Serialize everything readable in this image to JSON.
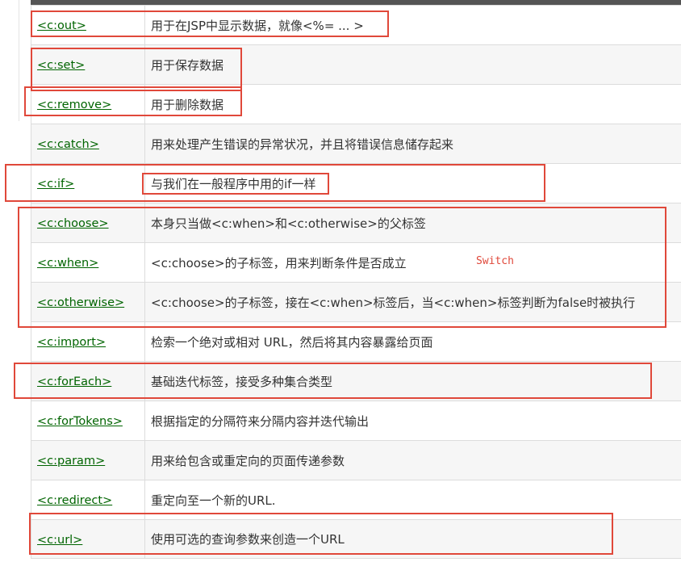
{
  "rows": [
    {
      "tag": "<c:out>",
      "desc": "用于在JSP中显示数据，就像<%= ... >"
    },
    {
      "tag": "<c:set>",
      "desc": "用于保存数据"
    },
    {
      "tag": "<c:remove>",
      "desc": "用于删除数据"
    },
    {
      "tag": "<c:catch>",
      "desc": "用来处理产生错误的异常状况，并且将错误信息储存起来"
    },
    {
      "tag": "<c:if>",
      "desc": "与我们在一般程序中用的if一样"
    },
    {
      "tag": "<c:choose>",
      "desc": "本身只当做<c:when>和<c:otherwise>的父标签"
    },
    {
      "tag": "<c:when>",
      "desc": "<c:choose>的子标签，用来判断条件是否成立"
    },
    {
      "tag": "<c:otherwise>",
      "desc": "<c:choose>的子标签，接在<c:when>标签后，当<c:when>标签判断为false时被执行"
    },
    {
      "tag": "<c:import>",
      "desc": "检索一个绝对或相对 URL，然后将其内容暴露给页面"
    },
    {
      "tag": "<c:forEach>",
      "desc": "基础迭代标签，接受多种集合类型"
    },
    {
      "tag": "<c:forTokens>",
      "desc": "根据指定的分隔符来分隔内容并迭代输出"
    },
    {
      "tag": "<c:param>",
      "desc": "用来给包含或重定向的页面传递参数"
    },
    {
      "tag": "<c:redirect>",
      "desc": "重定向至一个新的URL."
    },
    {
      "tag": "<c:url>",
      "desc": "使用可选的查询参数来创造一个URL"
    }
  ],
  "annotation": {
    "switch_note": "Switch"
  },
  "colors": {
    "link": "#006400",
    "highlight_box": "#e0483a",
    "text": "#333333"
  }
}
